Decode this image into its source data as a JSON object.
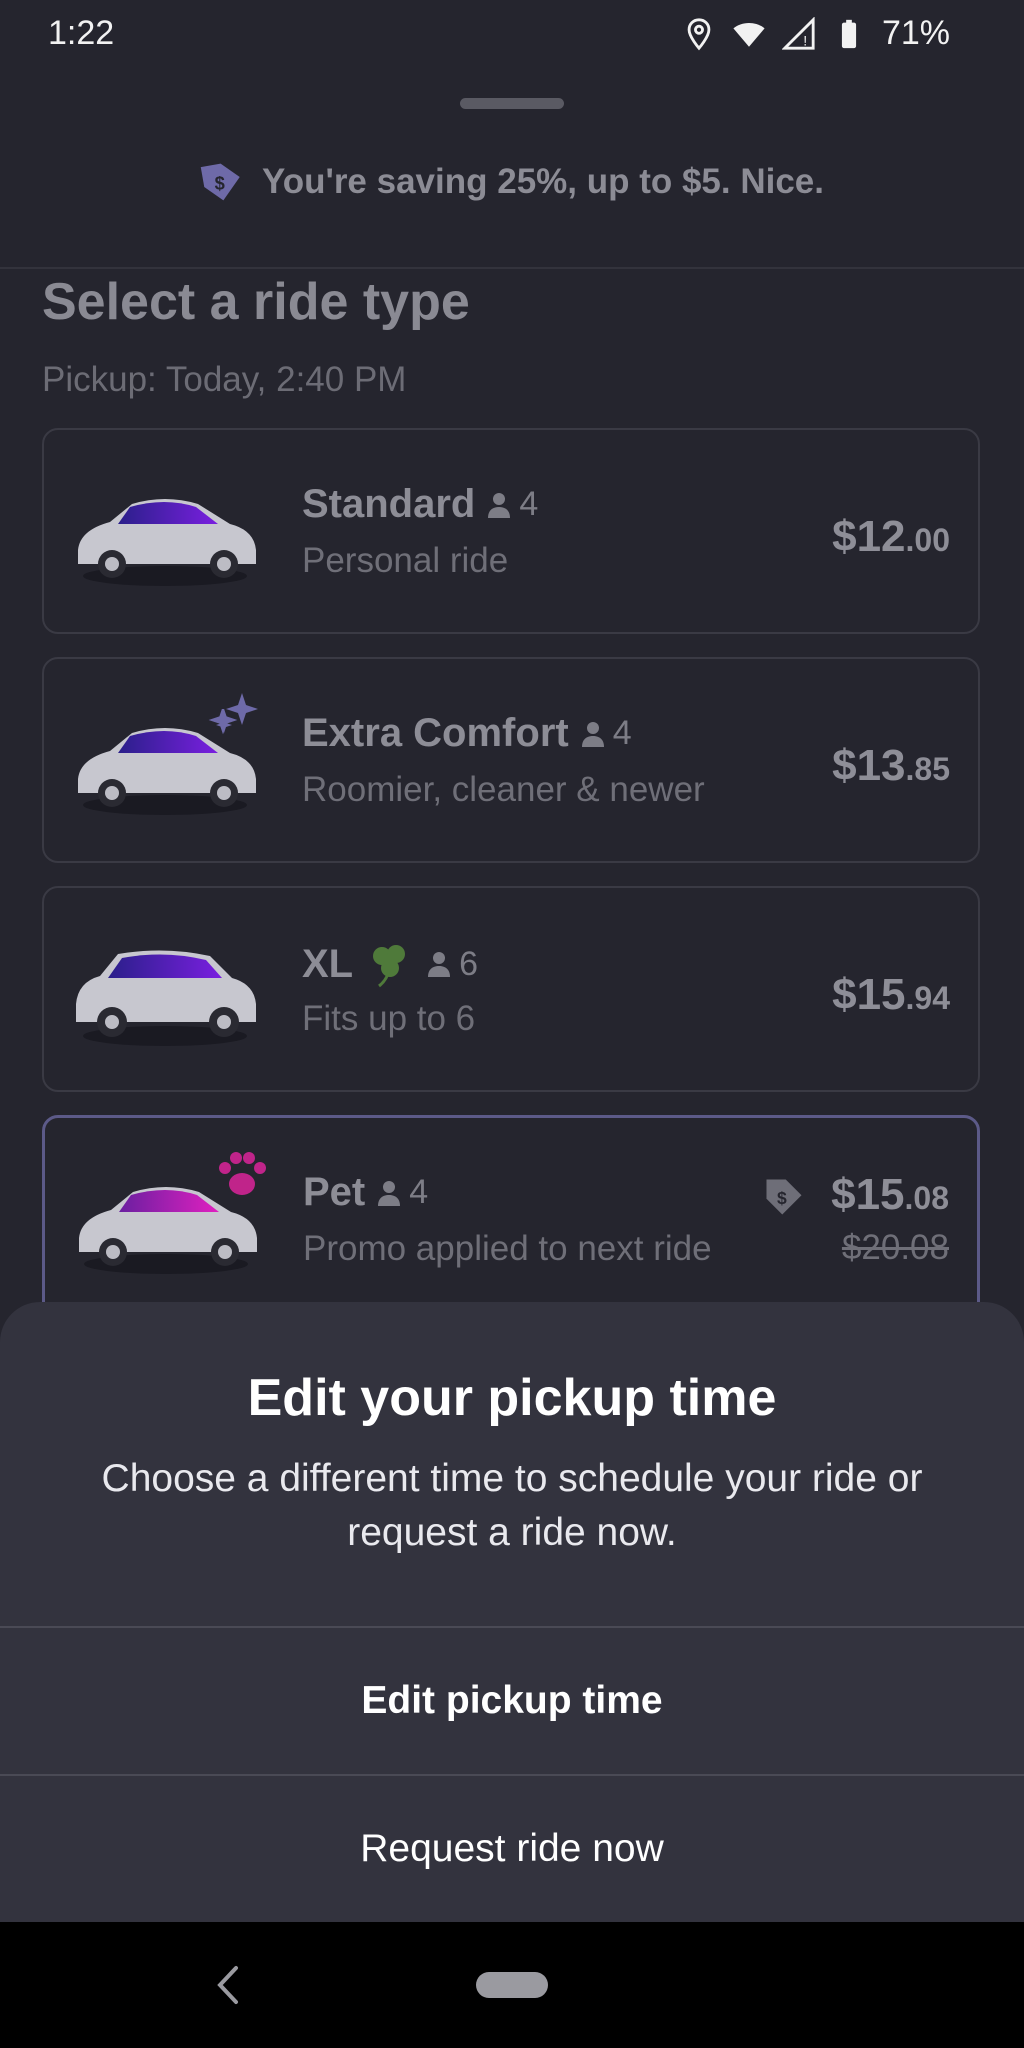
{
  "status_bar": {
    "time": "1:22",
    "battery": "71%"
  },
  "promo_banner": {
    "text": "You're saving 25%, up to $5. Nice.",
    "icon": "discount-tag-icon"
  },
  "header": {
    "title": "Select a ride type",
    "pickup": "Pickup: Today, 2:40 PM"
  },
  "rides": [
    {
      "name": "Standard",
      "seats": "4",
      "subtitle": "Personal ride",
      "price_dollars": "$12",
      "price_cents": ".00",
      "icon": "car-icon"
    },
    {
      "name": "Extra Comfort",
      "seats": "4",
      "subtitle": "Roomier, cleaner & newer",
      "price_dollars": "$13",
      "price_cents": ".85",
      "icon": "car-sparkle-icon"
    },
    {
      "name": "XL",
      "seats": "6",
      "subtitle": "Fits up to 6",
      "price_dollars": "$15",
      "price_cents": ".94",
      "icon": "suv-icon"
    },
    {
      "name": "Pet",
      "seats": "4",
      "subtitle": "Promo applied to next ride",
      "price_dollars": "$15",
      "price_cents": ".08",
      "original_price": "$20.08",
      "icon": "car-paw-icon"
    }
  ],
  "sheet": {
    "title": "Edit your pickup time",
    "body": "Choose a different time to schedule your ride or request a ride now.",
    "edit_button": "Edit pickup time",
    "request_button": "Request ride now"
  },
  "colors": {
    "background": "#25252e",
    "sheet": "#33333e",
    "accent_purple": "#5c5a88",
    "pet_pink": "#c0248a"
  }
}
